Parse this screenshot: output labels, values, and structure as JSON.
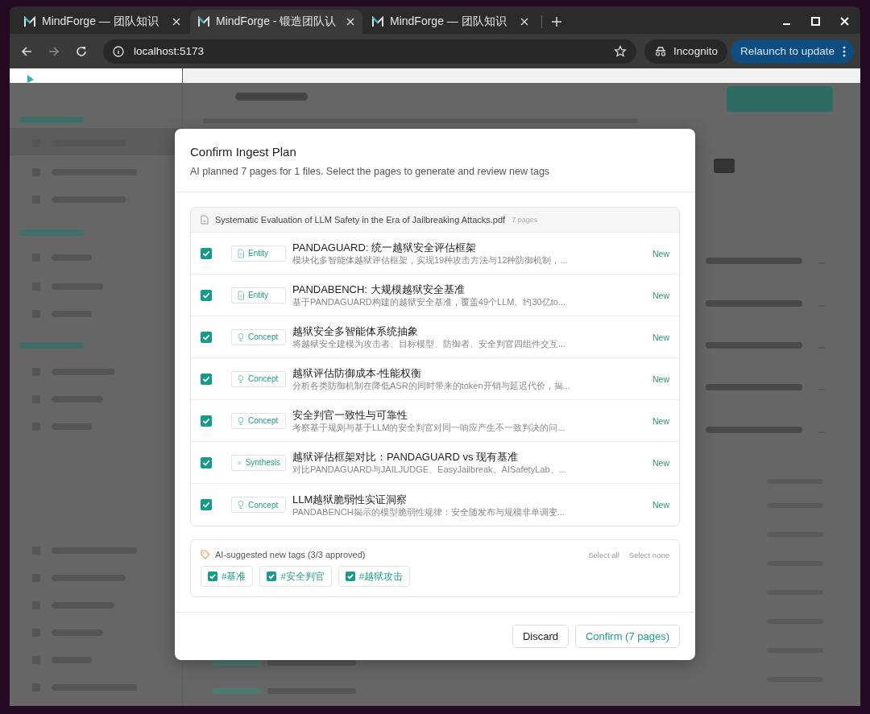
{
  "browser": {
    "tabs": [
      {
        "title": "MindForge — 团队知识",
        "selected": false
      },
      {
        "title": "MindForge - 锻造团队认",
        "selected": true
      },
      {
        "title": "MindForge — 团队知识",
        "selected": false
      }
    ],
    "address": "localhost:5173",
    "incognito": "Incognito",
    "relaunch": "Relaunch to update"
  },
  "dialog": {
    "title": "Confirm Ingest Plan",
    "subtitle": "AI planned 7 pages for 1 files. Select the pages to generate and review new tags",
    "file": {
      "name": "Systematic Evaluation of LLM Safety in the Era of Jailbreaking Attacks.pdf",
      "count": "7 pages"
    },
    "items": [
      {
        "checked": true,
        "kind": "entity",
        "type_label": "Entity",
        "title": "PANDAGUARD: 统一越狱安全评估框架",
        "summary": "模块化多智能体越狱评估框架，实现19种攻击方法与12种防御机制，...",
        "status": "New"
      },
      {
        "checked": true,
        "kind": "entity",
        "type_label": "Entity",
        "title": "PANDABENCH: 大规模越狱安全基准",
        "summary": "基于PANDAGUARD构建的越狱安全基准，覆盖49个LLM、约30亿to...",
        "status": "New"
      },
      {
        "checked": true,
        "kind": "concept",
        "type_label": "Concept",
        "title": "越狱安全多智能体系统抽象",
        "summary": "将越狱安全建模为攻击者、目标模型、防御者、安全判官四组件交互...",
        "status": "New"
      },
      {
        "checked": true,
        "kind": "concept",
        "type_label": "Concept",
        "title": "越狱评估防御成本-性能权衡",
        "summary": "分析各类防御机制在降低ASR的同时带来的token开销与延迟代价，揭...",
        "status": "New"
      },
      {
        "checked": true,
        "kind": "concept",
        "type_label": "Concept",
        "title": "安全判官一致性与可靠性",
        "summary": "考察基于规则与基于LLM的安全判官对同一响应产生不一致判决的问...",
        "status": "New"
      },
      {
        "checked": true,
        "kind": "synthesis",
        "type_label": "Synthesis",
        "title": "越狱评估框架对比：PANDAGUARD vs 现有基准",
        "summary": "对比PANDAGUARD与JAILJUDGE、EasyJailbreak、AISafetyLab、...",
        "status": "New"
      },
      {
        "checked": true,
        "kind": "concept",
        "type_label": "Concept",
        "title": "LLM越狱脆弱性实证洞察",
        "summary": "PANDABENCH揭示的模型脆弱性规律：安全随发布与规模非单调变...",
        "status": "New"
      }
    ],
    "tags": {
      "heading": "AI-suggested new tags (3/3 approved)",
      "select_all": "Select all",
      "select_none": "Select none",
      "items": [
        {
          "label": "#基准",
          "checked": true
        },
        {
          "label": "#安全判官",
          "checked": true
        },
        {
          "label": "#越狱攻击",
          "checked": true
        }
      ]
    },
    "buttons": {
      "discard": "Discard",
      "confirm": "Confirm (7 pages)"
    }
  }
}
